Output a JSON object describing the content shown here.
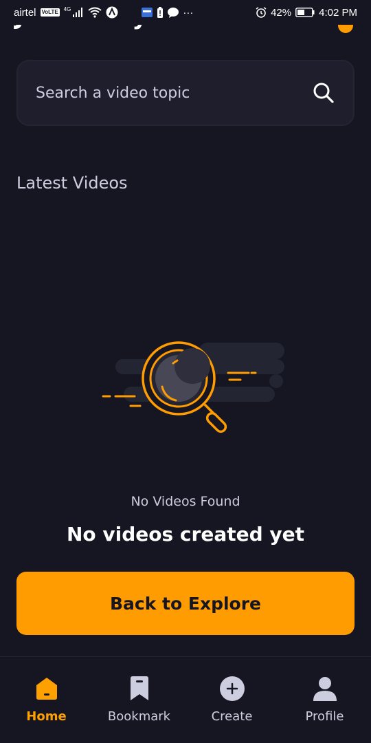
{
  "status_bar": {
    "carrier": "airtel",
    "volte": "VoLTE",
    "network": "4G",
    "more": "···",
    "battery": "42%",
    "time": "4:02 PM"
  },
  "header": {
    "partial_title": "JSMastery"
  },
  "search": {
    "placeholder": "Search a video topic",
    "icon": "search-icon"
  },
  "latest": {
    "title": "Latest Videos"
  },
  "empty_state": {
    "subtitle": "No Videos Found",
    "title": "No videos created yet",
    "button_label": "Back to Explore"
  },
  "tabs": [
    {
      "label": "Home",
      "icon": "home-icon",
      "active": true
    },
    {
      "label": "Bookmark",
      "icon": "bookmark-icon",
      "active": false
    },
    {
      "label": "Create",
      "icon": "plus-circle-icon",
      "active": false
    },
    {
      "label": "Profile",
      "icon": "profile-icon",
      "active": false
    }
  ],
  "colors": {
    "background": "#161622",
    "accent": "#FF9C01",
    "muted_text": "#CDCDE0",
    "surface": "#1E1E2D"
  }
}
